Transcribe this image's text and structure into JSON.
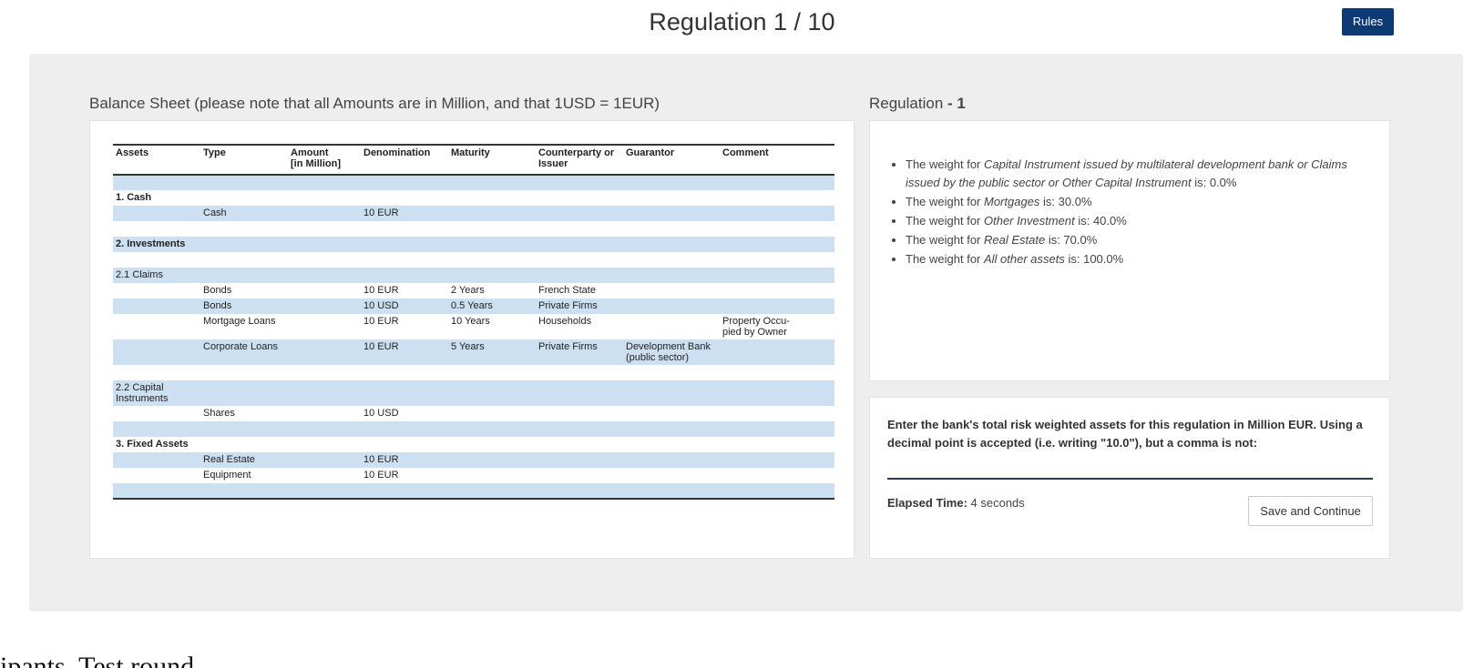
{
  "header": {
    "title": "Regulation 1 / 10",
    "rules_label": "Rules"
  },
  "balance_sheet": {
    "heading": "Balance Sheet (please note that all Amounts are in Million, and that 1USD = 1EUR)",
    "columns": [
      "Assets",
      "Type",
      "Amount\n[in Million]",
      "Denomination",
      "Maturity",
      "Counterparty or Issuer",
      "Guarantor",
      "Comment"
    ],
    "rows": [
      [
        "",
        "",
        "",
        "",
        "",
        "",
        "",
        ""
      ],
      [
        "1. Cash",
        "",
        "",
        "",
        "",
        "",
        "",
        ""
      ],
      [
        "",
        "Cash",
        "",
        "10 EUR",
        "",
        "",
        "",
        ""
      ],
      [
        "",
        "",
        "",
        "",
        "",
        "",
        "",
        ""
      ],
      [
        "2. Investments",
        "",
        "",
        "",
        "",
        "",
        "",
        ""
      ],
      [
        "",
        "",
        "",
        "",
        "",
        "",
        "",
        ""
      ],
      [
        "2.1 Claims",
        "",
        "",
        "",
        "",
        "",
        "",
        ""
      ],
      [
        "",
        "Bonds",
        "",
        "10 EUR",
        "2 Years",
        "French State",
        "",
        ""
      ],
      [
        "",
        "Bonds",
        "",
        "10 USD",
        "0.5 Years",
        "Private Firms",
        "",
        ""
      ],
      [
        "",
        "Mortgage Loans",
        "",
        "10 EUR",
        "10 Years",
        "Households",
        "",
        "Property Occu-\npied by Owner"
      ],
      [
        "",
        "Corporate Loans",
        "",
        "10 EUR",
        "5 Years",
        "Private Firms",
        "Development Bank\n(public sector)",
        ""
      ],
      [
        "",
        "",
        "",
        "",
        "",
        "",
        "",
        ""
      ],
      [
        "2.2 Capital\nInstruments",
        "",
        "",
        "",
        "",
        "",
        "",
        ""
      ],
      [
        "",
        "Shares",
        "",
        "10 USD",
        "",
        "",
        "",
        ""
      ],
      [
        "",
        "",
        "",
        "",
        "",
        "",
        "",
        ""
      ],
      [
        "3. Fixed Assets",
        "",
        "",
        "",
        "",
        "",
        "",
        ""
      ],
      [
        "",
        "Real Estate",
        "",
        "10 EUR",
        "",
        "",
        "",
        ""
      ],
      [
        "",
        "Equipment",
        "",
        "10 EUR",
        "",
        "",
        "",
        ""
      ],
      [
        "",
        "",
        "",
        "",
        "",
        "",
        "",
        ""
      ]
    ]
  },
  "regulation": {
    "heading_prefix": "Regulation ",
    "heading_bold": "- 1",
    "items": [
      {
        "pre": "The weight for ",
        "em": "Capital Instrument issued by multilateral development bank or Claims issued by the public sector or Other Capital Instrument",
        "post": " is: 0.0%"
      },
      {
        "pre": "The weight for ",
        "em": "Mortgages",
        "post": " is: 30.0%"
      },
      {
        "pre": "The weight for ",
        "em": "Other Investment",
        "post": " is: 40.0%"
      },
      {
        "pre": "The weight for ",
        "em": "Real Estate",
        "post": " is: 70.0%"
      },
      {
        "pre": "The weight for ",
        "em": "All other assets",
        "post": " is: 100.0%"
      }
    ]
  },
  "answer": {
    "prompt": "Enter the bank's total risk weighted assets for this regulation in Million EUR. Using a decimal point is accepted (i.e. writing \"10.0\"), but a comma is not:",
    "value": "",
    "elapsed_label": "Elapsed Time:",
    "elapsed_value": " 4 seconds",
    "save_label": "Save and Continue"
  },
  "footer": {
    "text": "ipants. Test round"
  }
}
